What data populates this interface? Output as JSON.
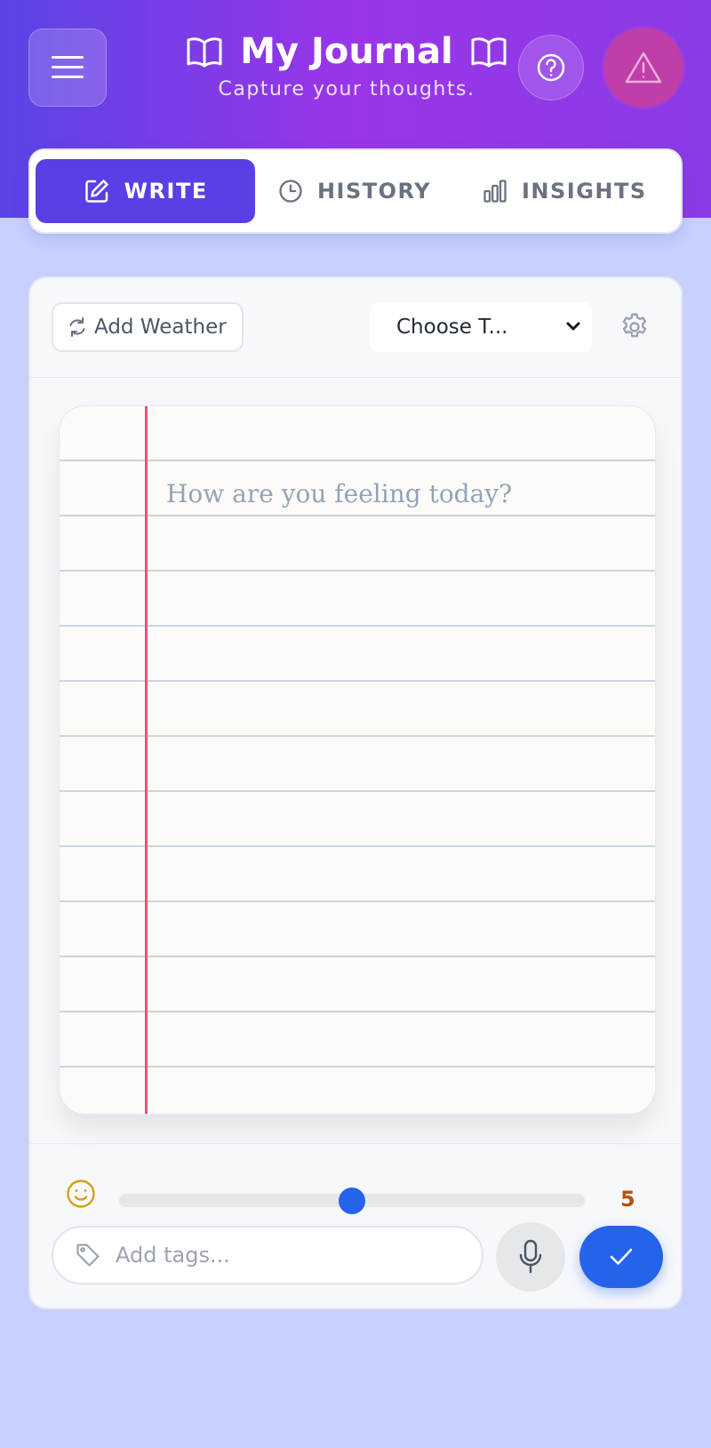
{
  "header": {
    "title": "My Journal",
    "subtitle": "Capture your thoughts."
  },
  "tabs": [
    {
      "label": "WRITE",
      "icon": "pencil-icon",
      "active": true
    },
    {
      "label": "HISTORY",
      "icon": "clock-icon",
      "active": false
    },
    {
      "label": "INSIGHTS",
      "icon": "bar-chart-icon",
      "active": false
    }
  ],
  "toolbar": {
    "weather_label": "Add Weather",
    "template_select": "Choose T..."
  },
  "editor": {
    "placeholder": "How are you feeling today?",
    "value": ""
  },
  "mood": {
    "value": "5",
    "min": 0,
    "max": 10
  },
  "tags": {
    "placeholder": "Add tags...",
    "value": ""
  },
  "colors": {
    "accent": "#5b3ee6",
    "primary_button": "#2563eb",
    "margin_line": "#e25578",
    "mood_value": "#b45309",
    "alert": "#c13ea8",
    "background": "#c7d0fe"
  }
}
